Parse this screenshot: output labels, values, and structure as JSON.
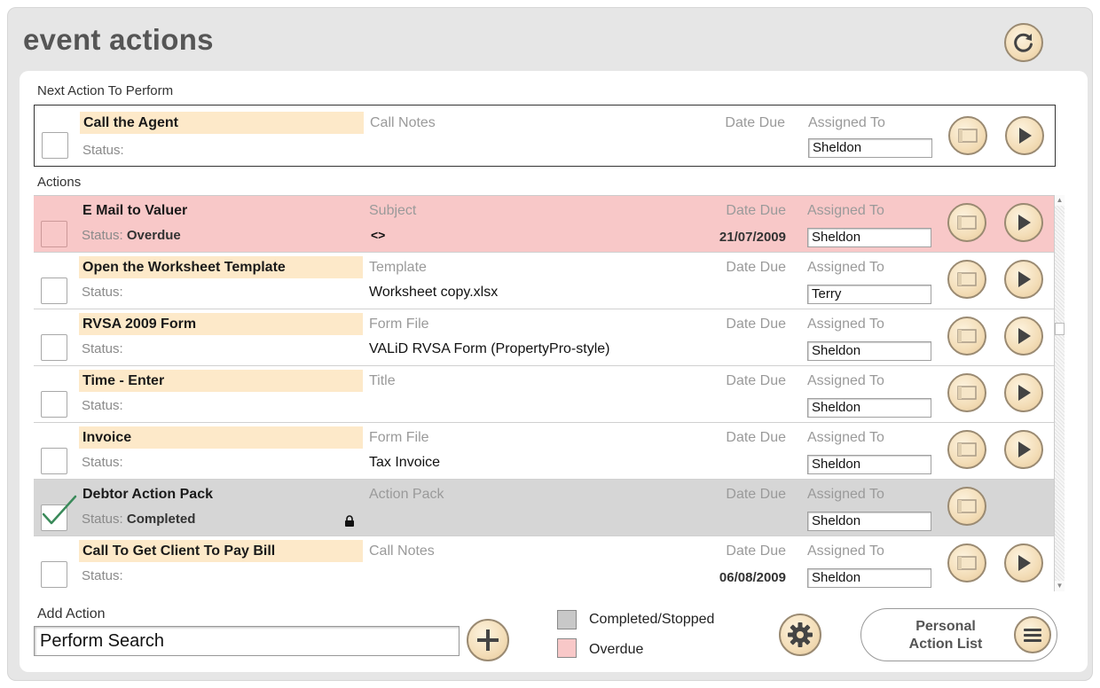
{
  "page": {
    "title": "event actions"
  },
  "next_action": {
    "section_label": "Next Action To Perform",
    "name": "Call the Agent",
    "status_label": "Status:",
    "status_value": "",
    "field_label": "Call Notes",
    "field_value": "",
    "date_label": "Date Due",
    "date_value": "",
    "assigned_label": "Assigned To",
    "assigned_value": "Sheldon"
  },
  "actions": {
    "section_label": "Actions",
    "rows": [
      {
        "name": "E Mail to Valuer",
        "status_label": "Status:",
        "status_value": "Overdue",
        "field_label": "Subject",
        "field_value": "<>",
        "date_label": "Date Due",
        "date_value": "21/07/2009",
        "assigned_label": "Assigned To",
        "assigned_value": "Sheldon",
        "state": "overdue",
        "checked": false
      },
      {
        "name": "Open the Worksheet Template",
        "status_label": "Status:",
        "status_value": "",
        "field_label": "Template",
        "field_value": "Worksheet copy.xlsx",
        "date_label": "Date Due",
        "date_value": "",
        "assigned_label": "Assigned To",
        "assigned_value": "Terry",
        "state": "normal",
        "checked": false
      },
      {
        "name": "RVSA 2009 Form",
        "status_label": "Status:",
        "status_value": "",
        "field_label": "Form File",
        "field_value": "VALiD RVSA Form (PropertyPro-style)",
        "date_label": "Date Due",
        "date_value": "",
        "assigned_label": "Assigned To",
        "assigned_value": "Sheldon",
        "state": "normal",
        "checked": false
      },
      {
        "name": "Time - Enter",
        "status_label": "Status:",
        "status_value": "",
        "field_label": "Title",
        "field_value": "",
        "date_label": "Date Due",
        "date_value": "",
        "assigned_label": "Assigned To",
        "assigned_value": "Sheldon",
        "state": "normal",
        "checked": false
      },
      {
        "name": "Invoice",
        "status_label": "Status:",
        "status_value": "",
        "field_label": "Form File",
        "field_value": "Tax Invoice",
        "date_label": "Date Due",
        "date_value": "",
        "assigned_label": "Assigned To",
        "assigned_value": "Sheldon",
        "state": "normal",
        "checked": false
      },
      {
        "name": "Debtor Action Pack",
        "status_label": "Status:",
        "status_value": "Completed",
        "field_label": "Action Pack",
        "field_value": "",
        "date_label": "Date Due",
        "date_value": "",
        "assigned_label": "Assigned To",
        "assigned_value": "Sheldon",
        "state": "completed",
        "checked": true
      },
      {
        "name": "Call To Get Client To Pay Bill",
        "status_label": "Status:",
        "status_value": "",
        "field_label": "Call Notes",
        "field_value": "",
        "date_label": "Date Due",
        "date_value": "06/08/2009",
        "assigned_label": "Assigned To",
        "assigned_value": "Sheldon",
        "state": "normal",
        "checked": false
      }
    ]
  },
  "add_action": {
    "label": "Add Action",
    "value": "Perform Search"
  },
  "legend": [
    {
      "label": "Completed/Stopped",
      "color": "#c8c8c8"
    },
    {
      "label": "Overdue",
      "color": "#f8c8c8"
    }
  ],
  "personal_list": {
    "line1": "Personal",
    "line2": "Action List"
  },
  "colors": {
    "highlight": "#fde9c9",
    "overdue": "#f8c8c8",
    "completed": "#d6d6d6",
    "button": "#f3ddb7",
    "check": "#3a8a5a"
  },
  "icons": [
    "refresh-icon",
    "note-icon",
    "play-icon",
    "plus-icon",
    "gear-icon",
    "menu-icon",
    "lock-icon",
    "checkmark-icon"
  ]
}
